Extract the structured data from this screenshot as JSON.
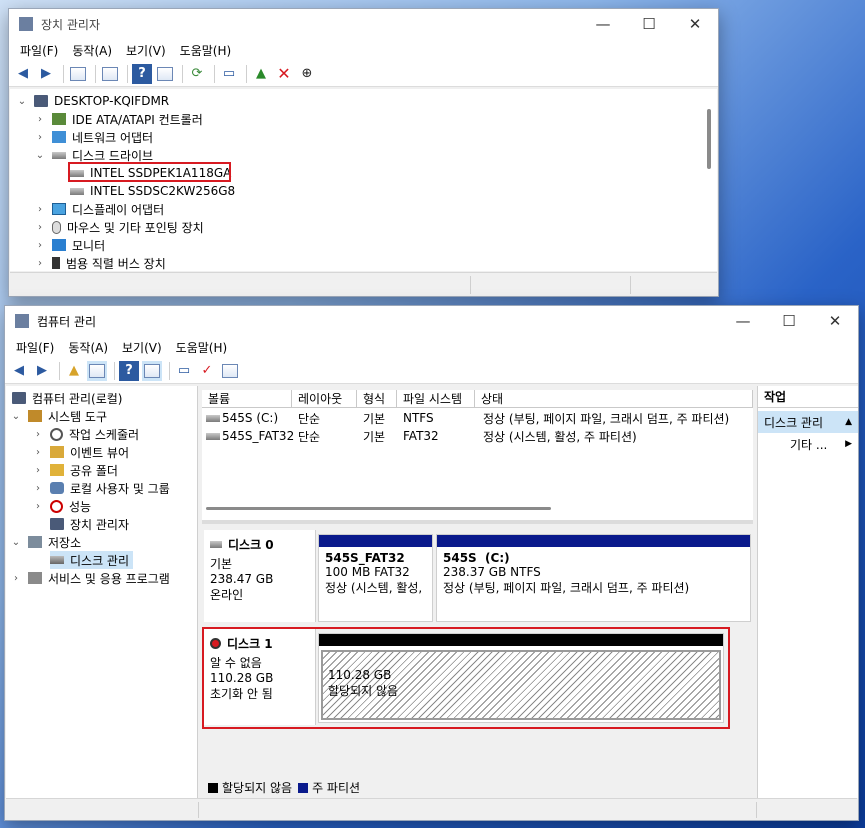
{
  "devmgr": {
    "title": "장치 관리자",
    "caption_buttons": {
      "minimize": "—",
      "maximize": "☐",
      "close": "✕"
    },
    "menu": [
      "파일(F)",
      "동작(A)",
      "보기(V)",
      "도움말(H)"
    ],
    "tree": {
      "root": "DESKTOP-KQIFDMR",
      "items": [
        {
          "label": "IDE ATA/ATAPI 컨트롤러",
          "icon": "ide-controller-icon"
        },
        {
          "label": "네트워크 어댑터",
          "icon": "network-adapter-icon"
        },
        {
          "label": "디스크 드라이브",
          "icon": "disk-drive-icon"
        },
        {
          "label": "INTEL SSDPEK1A118GA",
          "icon": "drive-icon"
        },
        {
          "label": "INTEL SSDSC2KW256G8",
          "icon": "drive-icon"
        },
        {
          "label": "디스플레이 어댑터",
          "icon": "display-adapter-icon"
        },
        {
          "label": "마우스 및 기타 포인팅 장치",
          "icon": "mouse-icon"
        },
        {
          "label": "모니터",
          "icon": "monitor-icon"
        },
        {
          "label": "범용 직렬 버스 장치",
          "icon": "usb-icon"
        }
      ]
    }
  },
  "compmgmt": {
    "title": "컴퓨터 관리",
    "caption_buttons": {
      "minimize": "—",
      "maximize": "☐",
      "close": "✕"
    },
    "menu": [
      "파일(F)",
      "동작(A)",
      "보기(V)",
      "도움말(H)"
    ],
    "nav": {
      "root": "컴퓨터 관리(로컬)",
      "items": [
        "시스템 도구",
        "작업 스케줄러",
        "이벤트 뷰어",
        "공유 폴더",
        "로컬 사용자 및 그룹",
        "성능",
        "장치 관리자",
        "저장소",
        "디스크 관리",
        "서비스 및 응용 프로그램"
      ]
    },
    "volumes": {
      "headers": [
        "볼륨",
        "레이아웃",
        "형식",
        "파일 시스템",
        "상태"
      ],
      "rows": [
        [
          "545S (C:)",
          "단순",
          "기본",
          "NTFS",
          "정상 (부팅, 페이지 파일, 크래시 덤프, 주 파티션)"
        ],
        [
          "545S_FAT32",
          "단순",
          "기본",
          "FAT32",
          "정상 (시스템, 활성, 주 파티션)"
        ]
      ]
    },
    "disks": [
      {
        "name": "디스크 0",
        "type": "기본",
        "size": "238.47 GB",
        "status": "온라인",
        "partitions": [
          {
            "name": "545S_FAT32",
            "detail": "100 MB FAT32",
            "status": "정상 (시스템, 활성,"
          },
          {
            "name": "545S  (C:)",
            "detail": "238.37 GB NTFS",
            "status": "정상 (부팅, 페이지 파일, 크래시 덤프, 주 파티션)"
          }
        ]
      },
      {
        "name": "디스크 1",
        "type": "알 수 없음",
        "size": "110.28 GB",
        "status": "초기화 안 됨",
        "partitions": [
          {
            "detail": "110.28 GB",
            "status": "할당되지 않음"
          }
        ]
      }
    ],
    "legend": [
      "할당되지 않음",
      "주 파티션"
    ],
    "actions": {
      "header": "작업",
      "section": "디스크 관리",
      "more": "기타 ..."
    },
    "colors": {
      "primary_partition": "#0a1a8c",
      "unallocated": "#000000",
      "highlight_red": "#d71a21",
      "selection": "#cce4f7"
    }
  }
}
